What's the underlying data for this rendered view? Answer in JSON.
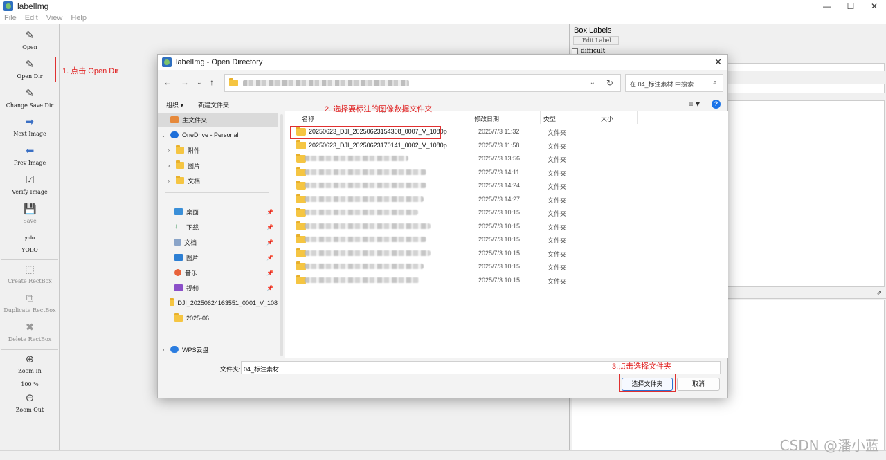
{
  "app": {
    "title": "labelImg",
    "window_controls": [
      "—",
      "☐",
      "✕"
    ]
  },
  "menu": [
    "File",
    "Edit",
    "View",
    "Help"
  ],
  "toolbar": [
    {
      "label": "Open",
      "icon": "✎",
      "enabled": true
    },
    {
      "label": "Open Dir",
      "icon": "✎",
      "enabled": true
    },
    {
      "label": "Change Save Dir",
      "icon": "✎",
      "enabled": true
    },
    {
      "label": "Next Image",
      "icon": "➡",
      "enabled": true
    },
    {
      "label": "Prev Image",
      "icon": "⬅",
      "enabled": true
    },
    {
      "label": "Verify Image",
      "icon": "☑",
      "enabled": true
    },
    {
      "label": "Save",
      "icon": "💾",
      "enabled": false
    },
    {
      "label": "YOLO",
      "icon": "yolo",
      "enabled": true
    },
    {
      "label": "Create RectBox",
      "icon": "⬚",
      "enabled": false
    },
    {
      "label": "Duplicate RectBox",
      "icon": "⧉",
      "enabled": false
    },
    {
      "label": "Delete RectBox",
      "icon": "✖",
      "enabled": false
    },
    {
      "label": "Zoom In",
      "icon": "⊕",
      "enabled": true
    },
    {
      "label": "100 %",
      "icon": "",
      "enabled": true
    },
    {
      "label": "Zoom Out",
      "icon": "⊖",
      "enabled": true
    }
  ],
  "dock": {
    "title": "Box Labels",
    "edit_label": "Edit Label",
    "difficult": "difficult",
    "second_panel_icon": "⇗"
  },
  "annotations": {
    "step1": "1. 点击 Open Dir",
    "step2": "2. 选择要标注的图像数据文件夹",
    "step3": "3.点击选择文件夹"
  },
  "dialog": {
    "title": "labelImg - Open Directory",
    "close": "✕",
    "search_placeholder": "在 04_标注素材 中搜索",
    "organize": "组织 ▾",
    "new_folder": "新建文件夹",
    "nav_pane": [
      {
        "label": "主文件夹",
        "icon": "home",
        "chev": "",
        "selected": true
      },
      {
        "label": "OneDrive - Personal",
        "icon": "cloud",
        "chev": "⌄"
      },
      {
        "label": "附件",
        "icon": "folder",
        "chev": "›"
      },
      {
        "label": "图片",
        "icon": "folder",
        "chev": "›"
      },
      {
        "label": "文档",
        "icon": "folder",
        "chev": "›"
      },
      {
        "label": "桌面",
        "icon": "desktop",
        "pin": true
      },
      {
        "label": "下载",
        "icon": "download",
        "pin": true
      },
      {
        "label": "文档",
        "icon": "doc",
        "pin": true
      },
      {
        "label": "图片",
        "icon": "image",
        "pin": true
      },
      {
        "label": "音乐",
        "icon": "music",
        "pin": true
      },
      {
        "label": "视频",
        "icon": "video",
        "pin": true
      },
      {
        "label": "DJI_20250624163551_0001_V_108",
        "icon": "folder"
      },
      {
        "label": "2025-06",
        "icon": "folder"
      },
      {
        "label": "WPS云盘",
        "icon": "cloud",
        "chev": "›"
      }
    ],
    "columns": {
      "name": "名称",
      "date": "修改日期",
      "type": "类型",
      "size": "大小"
    },
    "files": [
      {
        "name": "20250623_DJI_20250623154308_0007_V_1080p",
        "date": "2025/7/3 11:32",
        "type": "文件夹"
      },
      {
        "name": "20250623_DJI_20250623170141_0002_V_1080p",
        "date": "2025/7/3 11:58",
        "type": "文件夹"
      },
      {
        "name": "",
        "date": "2025/7/3 13:56",
        "type": "文件夹"
      },
      {
        "name": "",
        "date": "2025/7/3 14:11",
        "type": "文件夹"
      },
      {
        "name": "",
        "date": "2025/7/3 14:24",
        "type": "文件夹"
      },
      {
        "name": "",
        "date": "2025/7/3 14:27",
        "type": "文件夹"
      },
      {
        "name": "",
        "date": "2025/7/3 10:15",
        "type": "文件夹"
      },
      {
        "name": "",
        "date": "2025/7/3 10:15",
        "type": "文件夹"
      },
      {
        "name": "",
        "date": "2025/7/3 10:15",
        "type": "文件夹"
      },
      {
        "name": "",
        "date": "2025/7/3 10:15",
        "type": "文件夹"
      },
      {
        "name": "",
        "date": "2025/7/3 10:15",
        "type": "文件夹"
      },
      {
        "name": "",
        "date": "2025/7/3 10:15",
        "type": "文件夹"
      }
    ],
    "folder_label": "文件夹:",
    "folder_value": "04_标注素材",
    "select_button": "选择文件夹",
    "cancel_button": "取消"
  },
  "watermark": "CSDN @潘小蓝",
  "colors": {
    "accent": "#1a73e8",
    "annotation": "#e02020",
    "folder": "#f5c542"
  }
}
